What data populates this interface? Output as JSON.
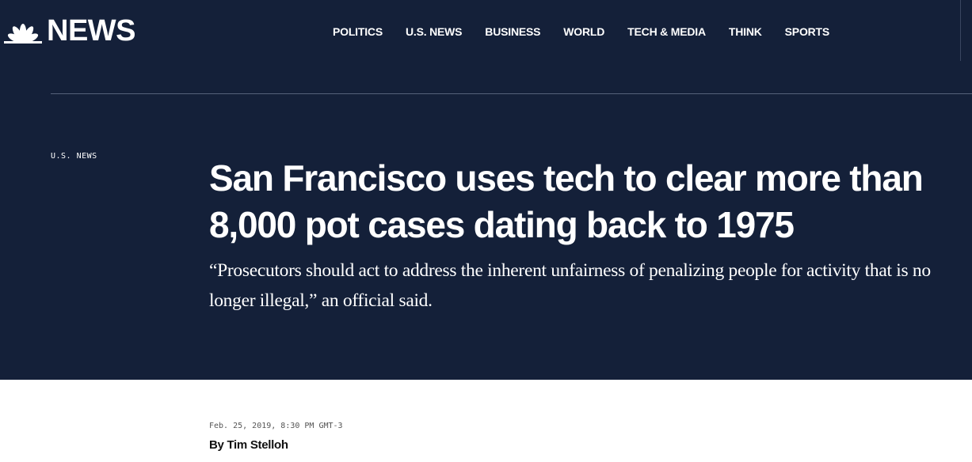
{
  "header": {
    "logo_text": "NEWS",
    "logo_icon": "peacock-icon",
    "nav": [
      {
        "label": "POLITICS"
      },
      {
        "label": "U.S. NEWS"
      },
      {
        "label": "BUSINESS"
      },
      {
        "label": "WORLD"
      },
      {
        "label": "TECH & MEDIA"
      },
      {
        "label": "THINK"
      },
      {
        "label": "SPORTS"
      }
    ]
  },
  "article": {
    "section": "U.S. NEWS",
    "headline": "San Francisco uses tech to clear more than 8,000 pot cases dating back to 1975",
    "dek": "“Prosecutors should act to address the inherent unfairness of penalizing people for activity that is no longer illegal,” an official said.",
    "dateline": "Feb. 25, 2019, 8:30 PM GMT-3",
    "byline_prefix": "By",
    "author": "Tim Stelloh"
  },
  "colors": {
    "hero_background": "#142039",
    "text_on_dark": "#ffffff",
    "page_background": "#ffffff"
  }
}
